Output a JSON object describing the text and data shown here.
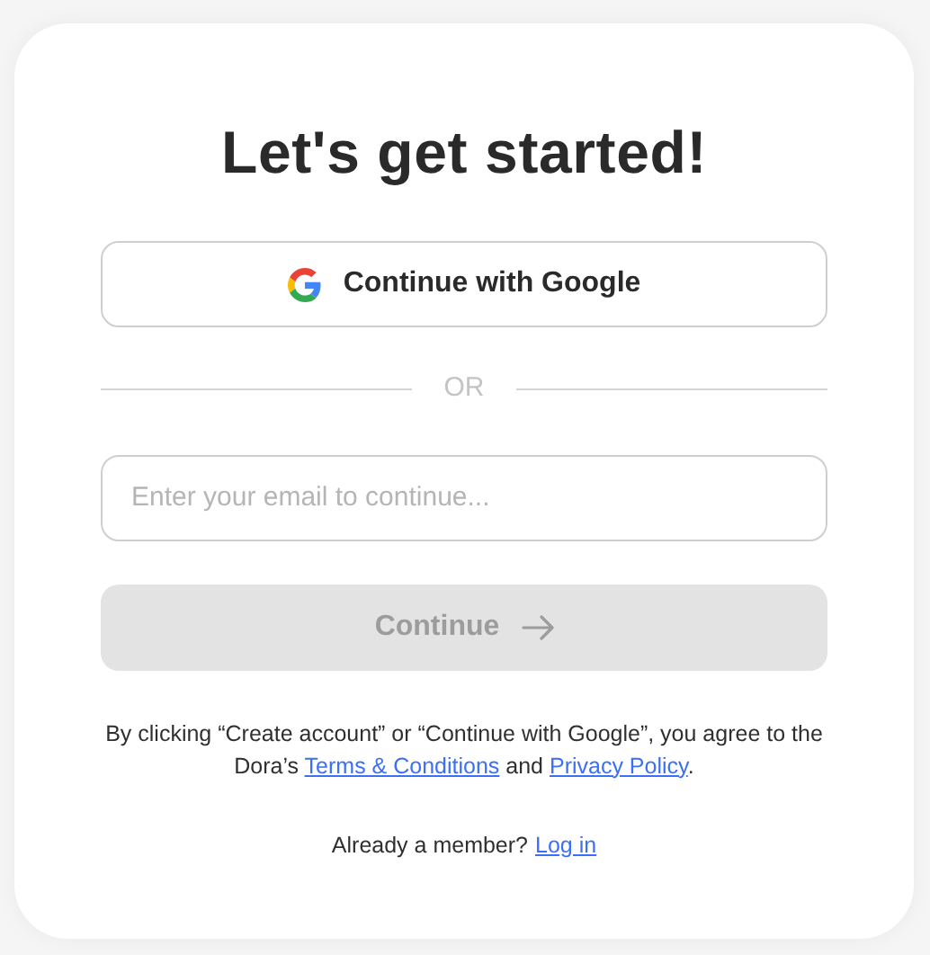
{
  "title": "Let's get started!",
  "google_button": {
    "label": "Continue with Google"
  },
  "divider": {
    "label": "OR"
  },
  "email_field": {
    "placeholder": "Enter your email to continue..."
  },
  "continue_button": {
    "label": "Continue",
    "disabled": true
  },
  "agreement": [
    {
      "kind": "text",
      "text": "By clicking “Create account” or “Continue with Google”, you agree to the Dora’s "
    },
    {
      "kind": "link",
      "text": "Terms & Conditions"
    },
    {
      "kind": "text",
      "text": " and "
    },
    {
      "kind": "link",
      "text": "Privacy Policy"
    },
    {
      "kind": "text",
      "text": "."
    }
  ],
  "login_prompt": {
    "text": "Already a member?",
    "link": "Log in"
  }
}
